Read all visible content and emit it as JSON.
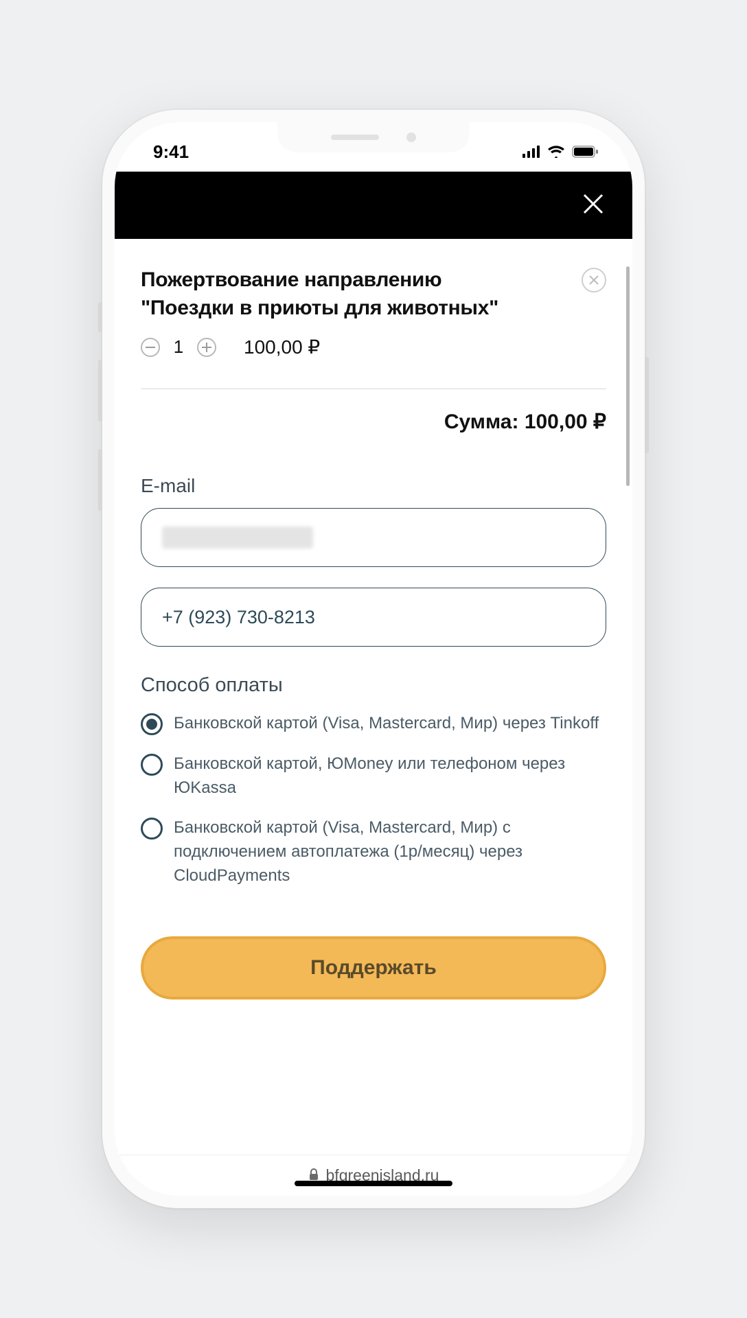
{
  "status": {
    "time": "9:41"
  },
  "product": {
    "title_line1": "Пожертвование направлению",
    "title_line2": "\"Поездки в приюты для животных\"",
    "quantity": "1",
    "price": "100,00  ₽"
  },
  "total": {
    "label": "Сумма:",
    "value": "100,00  ₽"
  },
  "form": {
    "email_label": "E-mail",
    "phone_value": "+7 (923) 730-8213"
  },
  "payment": {
    "section_label": "Способ оплаты",
    "options": [
      {
        "label": "Банковской картой (Visa, Mastercard, Мир) через Tinkoff",
        "checked": true
      },
      {
        "label": "Банковской картой, ЮMoney или телефоном через ЮKassa",
        "checked": false
      },
      {
        "label": "Банковской картой (Visa, Mastercard, Мир) с подключением автоплатежа (1р/месяц) через CloudPayments",
        "checked": false
      }
    ]
  },
  "submit_label": "Поддержать",
  "url": "bfgreenisland.ru"
}
